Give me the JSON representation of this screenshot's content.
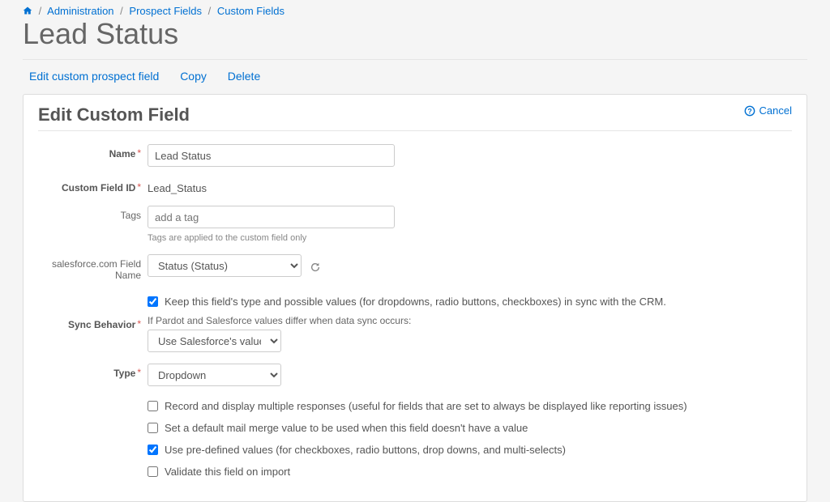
{
  "breadcrumb": {
    "admin": "Administration",
    "prospect": "Prospect Fields",
    "custom": "Custom Fields"
  },
  "page_title": "Lead Status",
  "actions": {
    "edit": "Edit custom prospect field",
    "copy": "Copy",
    "delete": "Delete"
  },
  "panel": {
    "title": "Edit Custom Field",
    "cancel": "Cancel"
  },
  "form": {
    "name_label": "Name",
    "name_value": "Lead Status",
    "id_label": "Custom Field ID",
    "id_value": "Lead_Status",
    "tags_label": "Tags",
    "tags_placeholder": "add a tag",
    "tags_help": "Tags are applied to the custom field only",
    "sf_label": "salesforce.com Field Name",
    "sf_value": "Status (Status)",
    "keep_sync": "Keep this field's type and possible values (for dropdowns, radio buttons, checkboxes) in sync with the CRM.",
    "sync_label": "Sync Behavior",
    "sync_note": "If Pardot and Salesforce values differ when data sync occurs:",
    "sync_value": "Use Salesforce's value",
    "type_label": "Type",
    "type_value": "Dropdown",
    "opt_record": "Record and display multiple responses (useful for fields that are set to always be displayed like reporting issues)",
    "opt_default": "Set a default mail merge value to be used when this field doesn't have a value",
    "opt_predefined": "Use pre-defined values (for checkboxes, radio buttons, drop downs, and multi-selects)",
    "opt_validate": "Validate this field on import"
  }
}
